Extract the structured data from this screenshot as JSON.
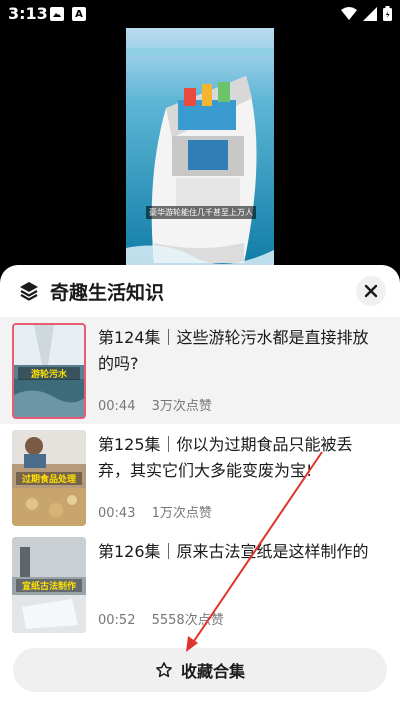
{
  "status": {
    "time": "3:13",
    "left_icons": [
      "image-icon",
      "a-icon"
    ],
    "right_icons": [
      "wifi-icon",
      "signal-icon",
      "battery-icon"
    ]
  },
  "video": {
    "caption": "豪华游轮能住几千甚至上万人"
  },
  "sheet": {
    "title": "奇趣生活知识",
    "episodes": [
      {
        "title": "第124集｜这些游轮污水都是直接排放的吗?",
        "duration": "00:44",
        "likes": "3万次点赞",
        "thumb_label": "游轮污水"
      },
      {
        "title": "第125集｜你以为过期食品只能被丢弃，其实它们大多能变废为宝!",
        "duration": "00:43",
        "likes": "1万次点赞",
        "thumb_label": "过期食品处理"
      },
      {
        "title": "第126集｜原来古法宣纸是这样制作的",
        "duration": "00:52",
        "likes": "5558次点赞",
        "thumb_label": "宣纸古法制作"
      }
    ],
    "collect_label": "收藏合集"
  },
  "colors": {
    "accent": "#e85d75",
    "annotation": "#e0342d"
  }
}
